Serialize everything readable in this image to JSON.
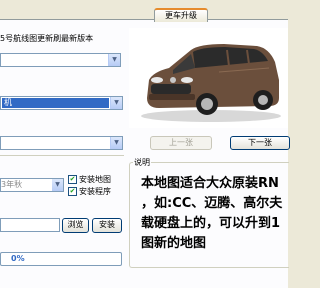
{
  "tabs": [
    {
      "label": "更车升级",
      "active": true
    }
  ],
  "left": {
    "prompt": "5号航线图更新刷最新版本",
    "combo1_value": "",
    "combo2_selected": "机",
    "combo3_value": "",
    "year_value": "3年秋",
    "checkboxes": [
      {
        "label": "安装地图",
        "checked": true
      },
      {
        "label": "安装程序",
        "checked": true
      }
    ],
    "path_value": "",
    "browse_label": "浏览",
    "install_label": "安装",
    "progress_text": "0%",
    "progress": 0
  },
  "pager": {
    "prev_label": "上一张",
    "next_label": "下一张"
  },
  "notes": {
    "legend": "说明",
    "lines": [
      "本地图适合大众原装RN",
      "，如:CC、迈腾、高尔夫",
      "载硬盘上的，可以升到1",
      "图新的地图"
    ]
  },
  "colors": {
    "car_body": "#6b4f3c",
    "selection": "#316ac5",
    "tab_accent": "#e68b2c"
  }
}
